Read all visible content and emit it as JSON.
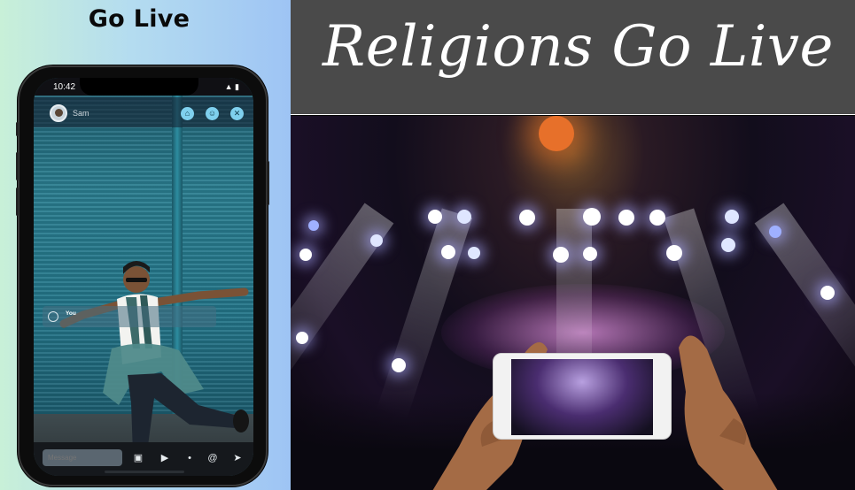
{
  "left_panel": {
    "title": "Go Live",
    "phone": {
      "time": "10:42",
      "status_icons": "▲ ▮",
      "header": {
        "host_name": "Sam",
        "buttons": [
          {
            "icon": "shop-icon",
            "glyph": "⌂"
          },
          {
            "icon": "user-icon",
            "glyph": "☺"
          },
          {
            "icon": "close-icon",
            "glyph": "✕"
          }
        ]
      },
      "comment": {
        "name": "You",
        "text": ""
      },
      "bottom_bar": {
        "message_placeholder": "Message",
        "tools": [
          {
            "icon": "gift-icon",
            "glyph": "▣"
          },
          {
            "icon": "video-icon",
            "glyph": "▶"
          },
          {
            "icon": "mic-icon",
            "glyph": "•"
          },
          {
            "icon": "mention-icon",
            "glyph": "@"
          },
          {
            "icon": "send-icon",
            "glyph": "➤"
          }
        ]
      }
    }
  },
  "right_panel": {
    "title": "Religions Go Live",
    "banner_color": "#4a4a4a"
  },
  "colors": {
    "accent": "#7fd0ee",
    "screen_bg": "#237589"
  }
}
